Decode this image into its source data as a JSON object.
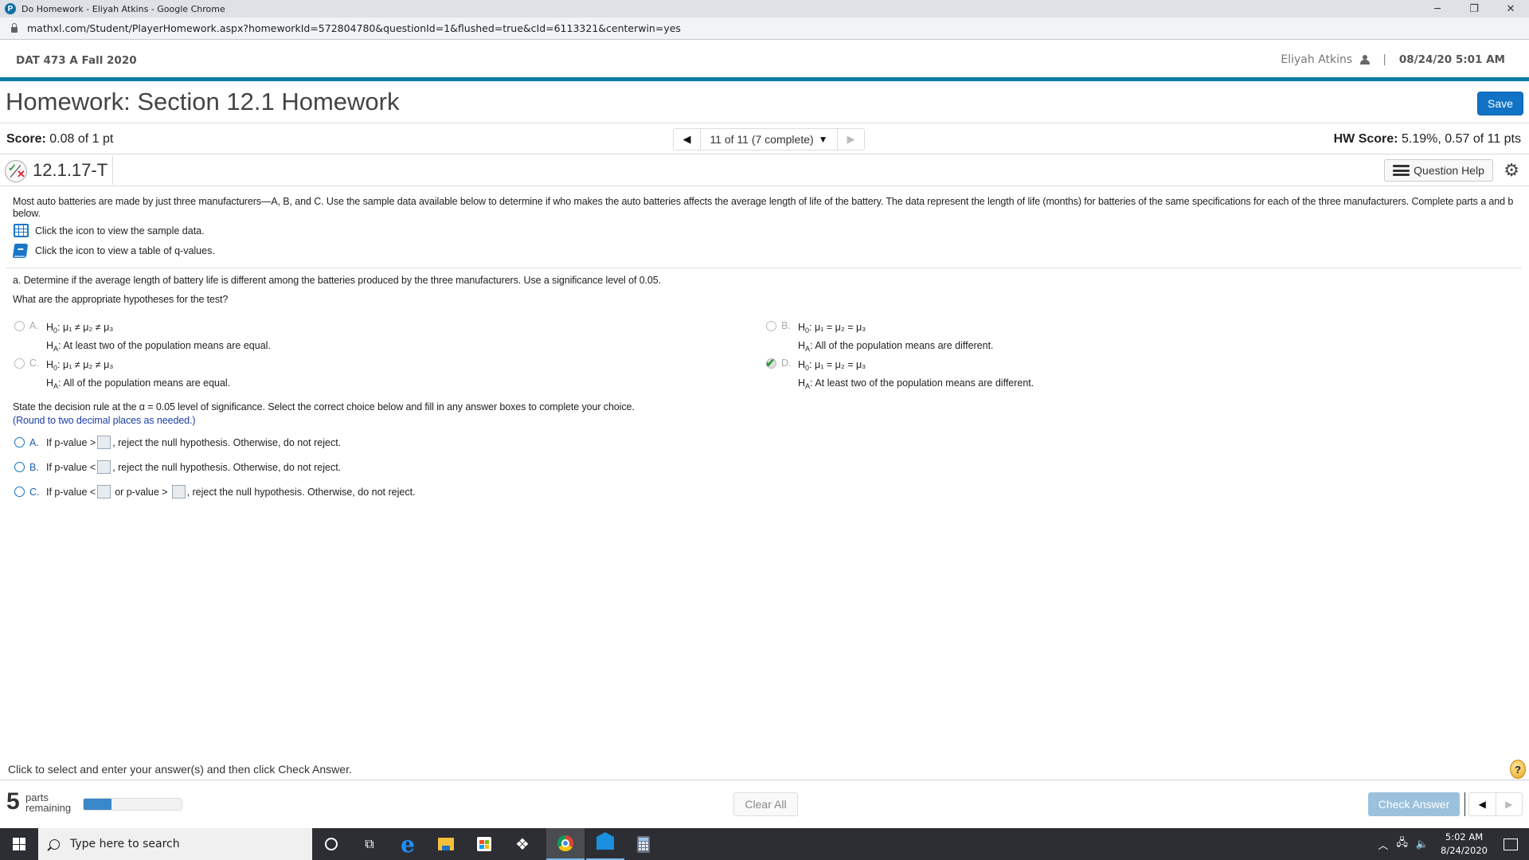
{
  "browser": {
    "window_title": "Do Homework - Eliyah Atkins - Google Chrome",
    "url": "mathxl.com/Student/PlayerHomework.aspx?homeworkId=572804780&questionId=1&flushed=true&cId=6113321&centerwin=yes",
    "controls": {
      "minimize": "─",
      "restore": "❐",
      "close": "✕"
    }
  },
  "header": {
    "course": "DAT 473 A Fall 2020",
    "user_name": "Eliyah Atkins",
    "separator": "|",
    "datetime": "08/24/20 5:01 AM",
    "accent_color": "#0a7ea4"
  },
  "page": {
    "title": "Homework: Section 12.1 Homework",
    "save_label": "Save"
  },
  "score_bar": {
    "score_label": "Score:",
    "score_value": "0.08 of 1 pt",
    "nav_position": "11 of 11 (7 complete)",
    "hw_score_label": "HW Score:",
    "hw_score_value": "5.19%, 0.57 of 11 pts"
  },
  "question": {
    "number": "12.1.17-T",
    "help_label": "Question Help",
    "intro": "Most auto batteries are made by just three manufacturers—A, B, and C. Use the sample data available below to determine if who makes the auto batteries affects the average length of life of the battery. The data represent the length of life (months) for batteries of the same specifications for each of the three manufacturers. Complete parts a and b below.",
    "links": [
      {
        "icon": "data-table-icon",
        "text": "Click the icon to view the sample data."
      },
      {
        "icon": "book-icon",
        "text": "Click the icon to view a table of q-values."
      }
    ],
    "part_a": "a. Determine if the average length of battery life is different among the batteries produced by the three manufacturers. Use a significance level of 0.05.",
    "hyp_prompt": "What are the appropriate hypotheses for the test?",
    "hypotheses": [
      {
        "letter": "A.",
        "h0": "μ₁ ≠ μ₂ ≠ μ₃",
        "ha": "At least two of the population means are equal.",
        "selected": false
      },
      {
        "letter": "B.",
        "h0": "μ₁ = μ₂ = μ₃",
        "ha": "All of the population means are different.",
        "selected": false
      },
      {
        "letter": "C.",
        "h0": "μ₁ ≠ μ₂ ≠ μ₃",
        "ha": "All of the population means are equal.",
        "selected": false
      },
      {
        "letter": "D.",
        "h0": "μ₁ = μ₂ = μ₃",
        "ha": "At least two of the population means are different.",
        "selected": true
      }
    ],
    "h0_label": "H",
    "h0_sub": "0",
    "ha_label": "H",
    "ha_sub": "A",
    "decision_prompt": "State the decision rule at the α = 0.05 level of significance. Select the correct choice below and fill in any answer boxes to complete your choice.",
    "round_hint": "(Round to two decimal places as needed.)",
    "decision_choices": [
      {
        "letter": "A.",
        "pre": "If p-value >",
        "post": ", reject the null hypothesis. Otherwise, do not reject.",
        "box1": "",
        "selected": false
      },
      {
        "letter": "B.",
        "pre": "If p-value <",
        "post": ", reject the null hypothesis. Otherwise, do not reject.",
        "box1": "",
        "selected": false
      },
      {
        "letter": "C.",
        "pre": "If p-value <",
        "mid": "or p-value >",
        "post": ", reject the null hypothesis. Otherwise, do not reject.",
        "box1": "",
        "box2": "",
        "selected": false
      }
    ]
  },
  "footer": {
    "instruction": "Click to select and enter your answer(s) and then click Check Answer.",
    "help_icon": "?",
    "parts_remaining_count": "5",
    "parts_remaining_label_1": "parts",
    "parts_remaining_label_2": "remaining",
    "progress_fraction": 0.286,
    "clear_all_label": "Clear All",
    "check_answer_label": "Check Answer"
  },
  "taskbar": {
    "search_placeholder": "Type here to search",
    "apps": [
      "cortana",
      "task-view",
      "edge",
      "file-explorer",
      "microsoft-store",
      "dropbox",
      "chrome",
      "mail",
      "calculator"
    ],
    "time": "5:02 AM",
    "date": "8/24/2020"
  }
}
